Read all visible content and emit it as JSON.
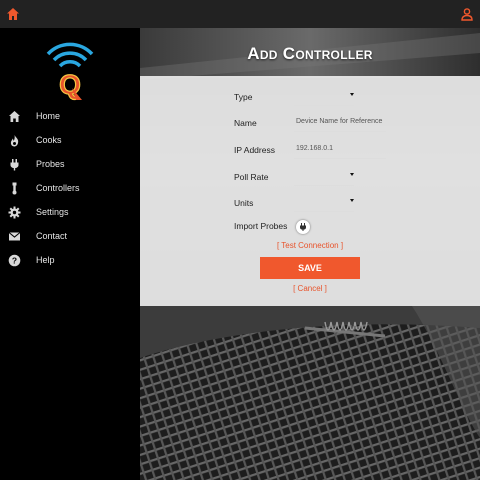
{
  "header": {
    "home_icon": "home-icon",
    "user_icon": "user-icon",
    "accent": "#e8532b"
  },
  "sidebar": {
    "logo_letter": "Q",
    "items": [
      {
        "label": "Home",
        "icon": "home-icon"
      },
      {
        "label": "Cooks",
        "icon": "flame-icon"
      },
      {
        "label": "Probes",
        "icon": "plug-icon"
      },
      {
        "label": "Controllers",
        "icon": "thermometer-icon"
      },
      {
        "label": "Settings",
        "icon": "gear-icon"
      },
      {
        "label": "Contact",
        "icon": "envelope-icon"
      },
      {
        "label": "Help",
        "icon": "help-icon"
      }
    ]
  },
  "page": {
    "title": "Add Controller"
  },
  "form": {
    "type_label": "Type",
    "type_value": "",
    "name_label": "Name",
    "name_placeholder": "Device Name for Reference",
    "ip_label": "IP Address",
    "ip_value": "192.168.0.1",
    "poll_label": "Poll Rate",
    "poll_value": "",
    "units_label": "Units",
    "units_value": "",
    "import_label": "Import Probes",
    "test_connection": "[ Test Connection ]",
    "save": "SAVE",
    "cancel": "[ Cancel ]"
  }
}
